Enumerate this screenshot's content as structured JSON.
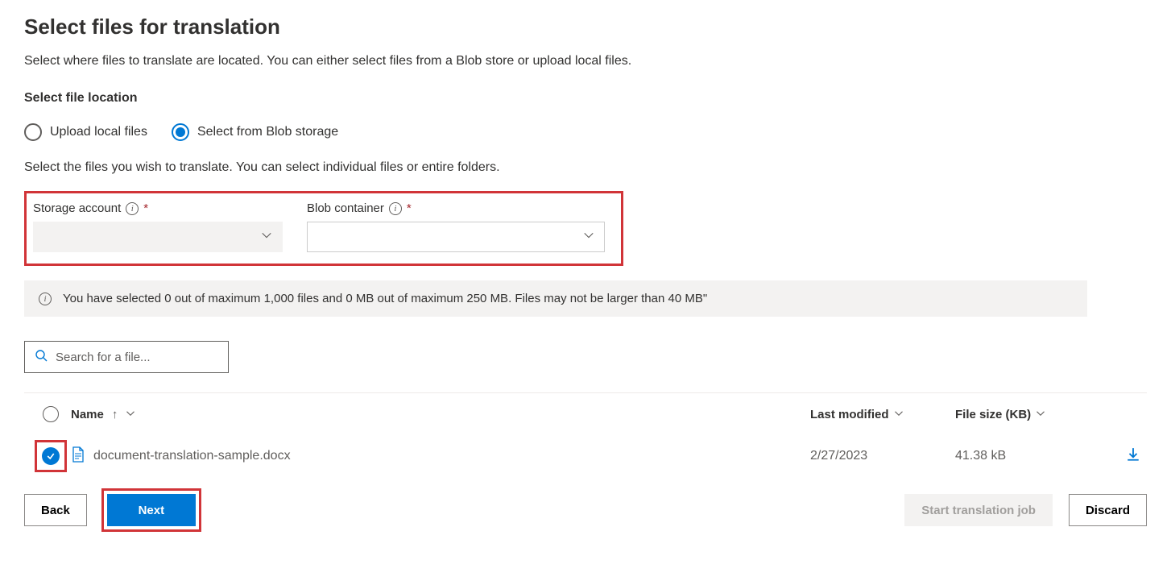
{
  "page": {
    "title": "Select files for translation",
    "subtitle": "Select where files to translate are located. You can either select files from a Blob store or upload local files.",
    "section_label": "Select file location",
    "help_text": "Select the files you wish to translate. You can select individual files or entire folders."
  },
  "radios": {
    "upload_label": "Upload local files",
    "blob_label": "Select from Blob storage"
  },
  "fields": {
    "storage_account_label": "Storage account",
    "blob_container_label": "Blob container"
  },
  "info_bar": {
    "text": "You have selected 0 out of maximum 1,000 files and 0 MB out of maximum 250 MB. Files may not be larger than 40 MB\""
  },
  "search": {
    "placeholder": "Search for a file..."
  },
  "table": {
    "headers": {
      "name": "Name",
      "last_modified": "Last modified",
      "file_size": "File size (KB)"
    },
    "rows": [
      {
        "name": "document-translation-sample.docx",
        "last_modified": "2/27/2023",
        "file_size": "41.38 kB",
        "checked": true
      }
    ]
  },
  "buttons": {
    "back": "Back",
    "next": "Next",
    "start_job": "Start translation job",
    "discard": "Discard"
  }
}
